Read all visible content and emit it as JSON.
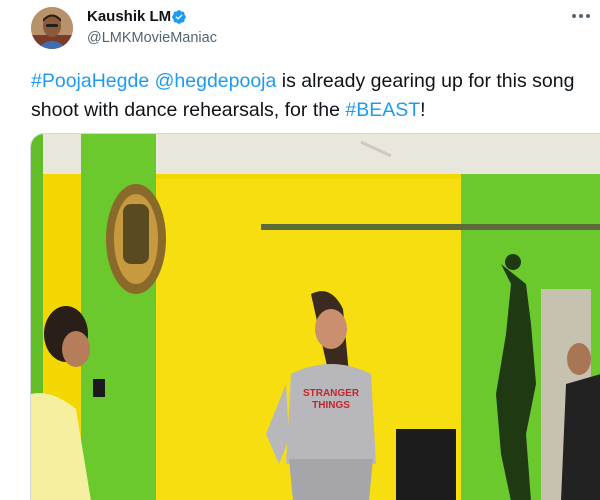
{
  "author": {
    "display_name": "Kaushik LM",
    "handle": "@LMKMovieManiac",
    "verified": true
  },
  "tweet": {
    "parts": [
      {
        "text": "#PoojaHegde",
        "kind": "hashtag"
      },
      {
        "text": " ",
        "kind": "text"
      },
      {
        "text": "@hegdepooja",
        "kind": "mention"
      },
      {
        "text": " is already gearing up for this song shoot with dance rehearsals, for the ",
        "kind": "text"
      },
      {
        "text": "#BEAST",
        "kind": "hashtag"
      },
      {
        "text": "!",
        "kind": "text"
      }
    ]
  },
  "media": {
    "shirt_text_line1": "STRANGER",
    "shirt_text_line2": "THINGS"
  },
  "icons": {
    "verified": "verified-badge-icon",
    "more": "more-options-icon"
  },
  "colors": {
    "link": "#1d9bf0",
    "text": "#0f1419",
    "secondary": "#536471",
    "wall_yellow": "#f2d800",
    "wall_green": "#6bc92e"
  }
}
